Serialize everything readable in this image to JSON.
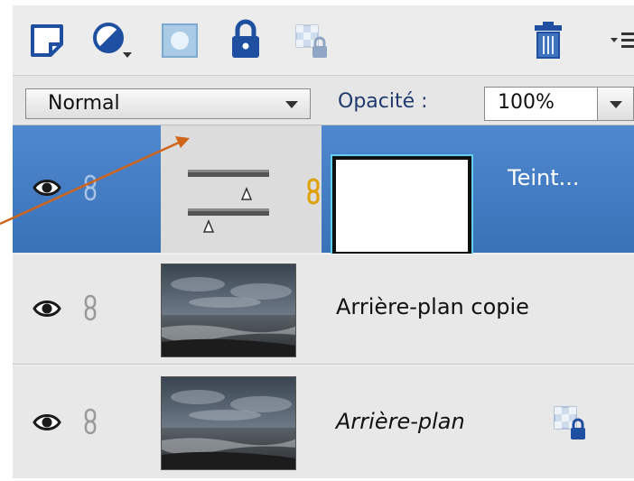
{
  "toolbar": {
    "icons": [
      "new-layer-icon",
      "adjustment-layer-icon",
      "add-mask-icon",
      "lock-all-icon",
      "lock-transparency-icon",
      "trash-icon",
      "panel-menu-icon"
    ]
  },
  "options": {
    "blend_mode": "Normal",
    "opacity_label": "Opacité :",
    "opacity_value": "100%"
  },
  "layers": [
    {
      "name": "Teint...",
      "selected": true,
      "type": "adjustment-with-mask"
    },
    {
      "name": "Arrière-plan copie",
      "selected": false,
      "type": "image"
    },
    {
      "name": "Arrière-plan",
      "selected": false,
      "type": "image",
      "italic": true,
      "locked": true
    }
  ],
  "colors": {
    "selection_blue": "#3f78c0",
    "annotation_arrow": "#d0651a",
    "mask_highlight": "#5fd0ee",
    "link_gold": "#e0a000"
  }
}
